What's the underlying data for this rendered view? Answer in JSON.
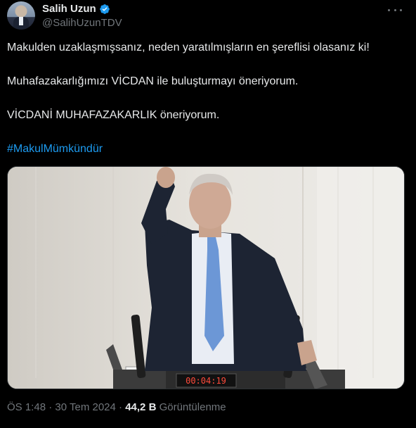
{
  "author": {
    "display_name": "Salih Uzun",
    "handle": "@SalihUzunTDV",
    "verified_color": "#1d9bf0"
  },
  "tweet": {
    "line1": "Makulden uzaklaşmışsanız, neden yaratılmışların en şereflisi olasanız ki!",
    "line2": "Muhafazakarlığımızı VİCDAN ile buluşturmayı öneriyorum.",
    "line3": "VİCDANİ MUHAFAZAKARLIK öneriyorum.",
    "hashtag": "#MakulMümkündür"
  },
  "media": {
    "timer": "00:04:19"
  },
  "meta": {
    "time": "ÖS 1:48",
    "sep1": " · ",
    "date": "30 Tem 2024",
    "sep2": " · ",
    "views_count": "44,2 B",
    "views_label": " Görüntülenme"
  },
  "colors": {
    "accent": "#1d9bf0",
    "secondary_text": "#71767b",
    "background": "#000000"
  }
}
